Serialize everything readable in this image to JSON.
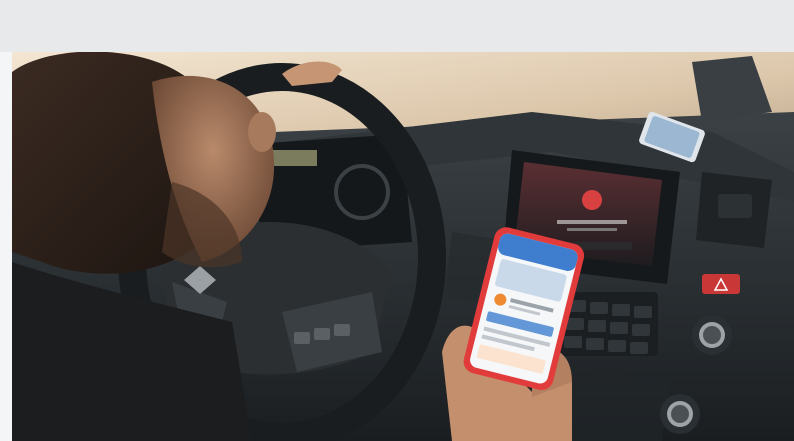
{
  "image": {
    "subject": "truck-cab-interior",
    "colors": {
      "top_band": "#e7e9ea",
      "windshield_light": "#e9d8c1",
      "dashboard_dark": "#2b3034",
      "phone_case": "#e23b3b",
      "infotainment_red": "#d94141",
      "hazard_button": "#c93737"
    }
  }
}
